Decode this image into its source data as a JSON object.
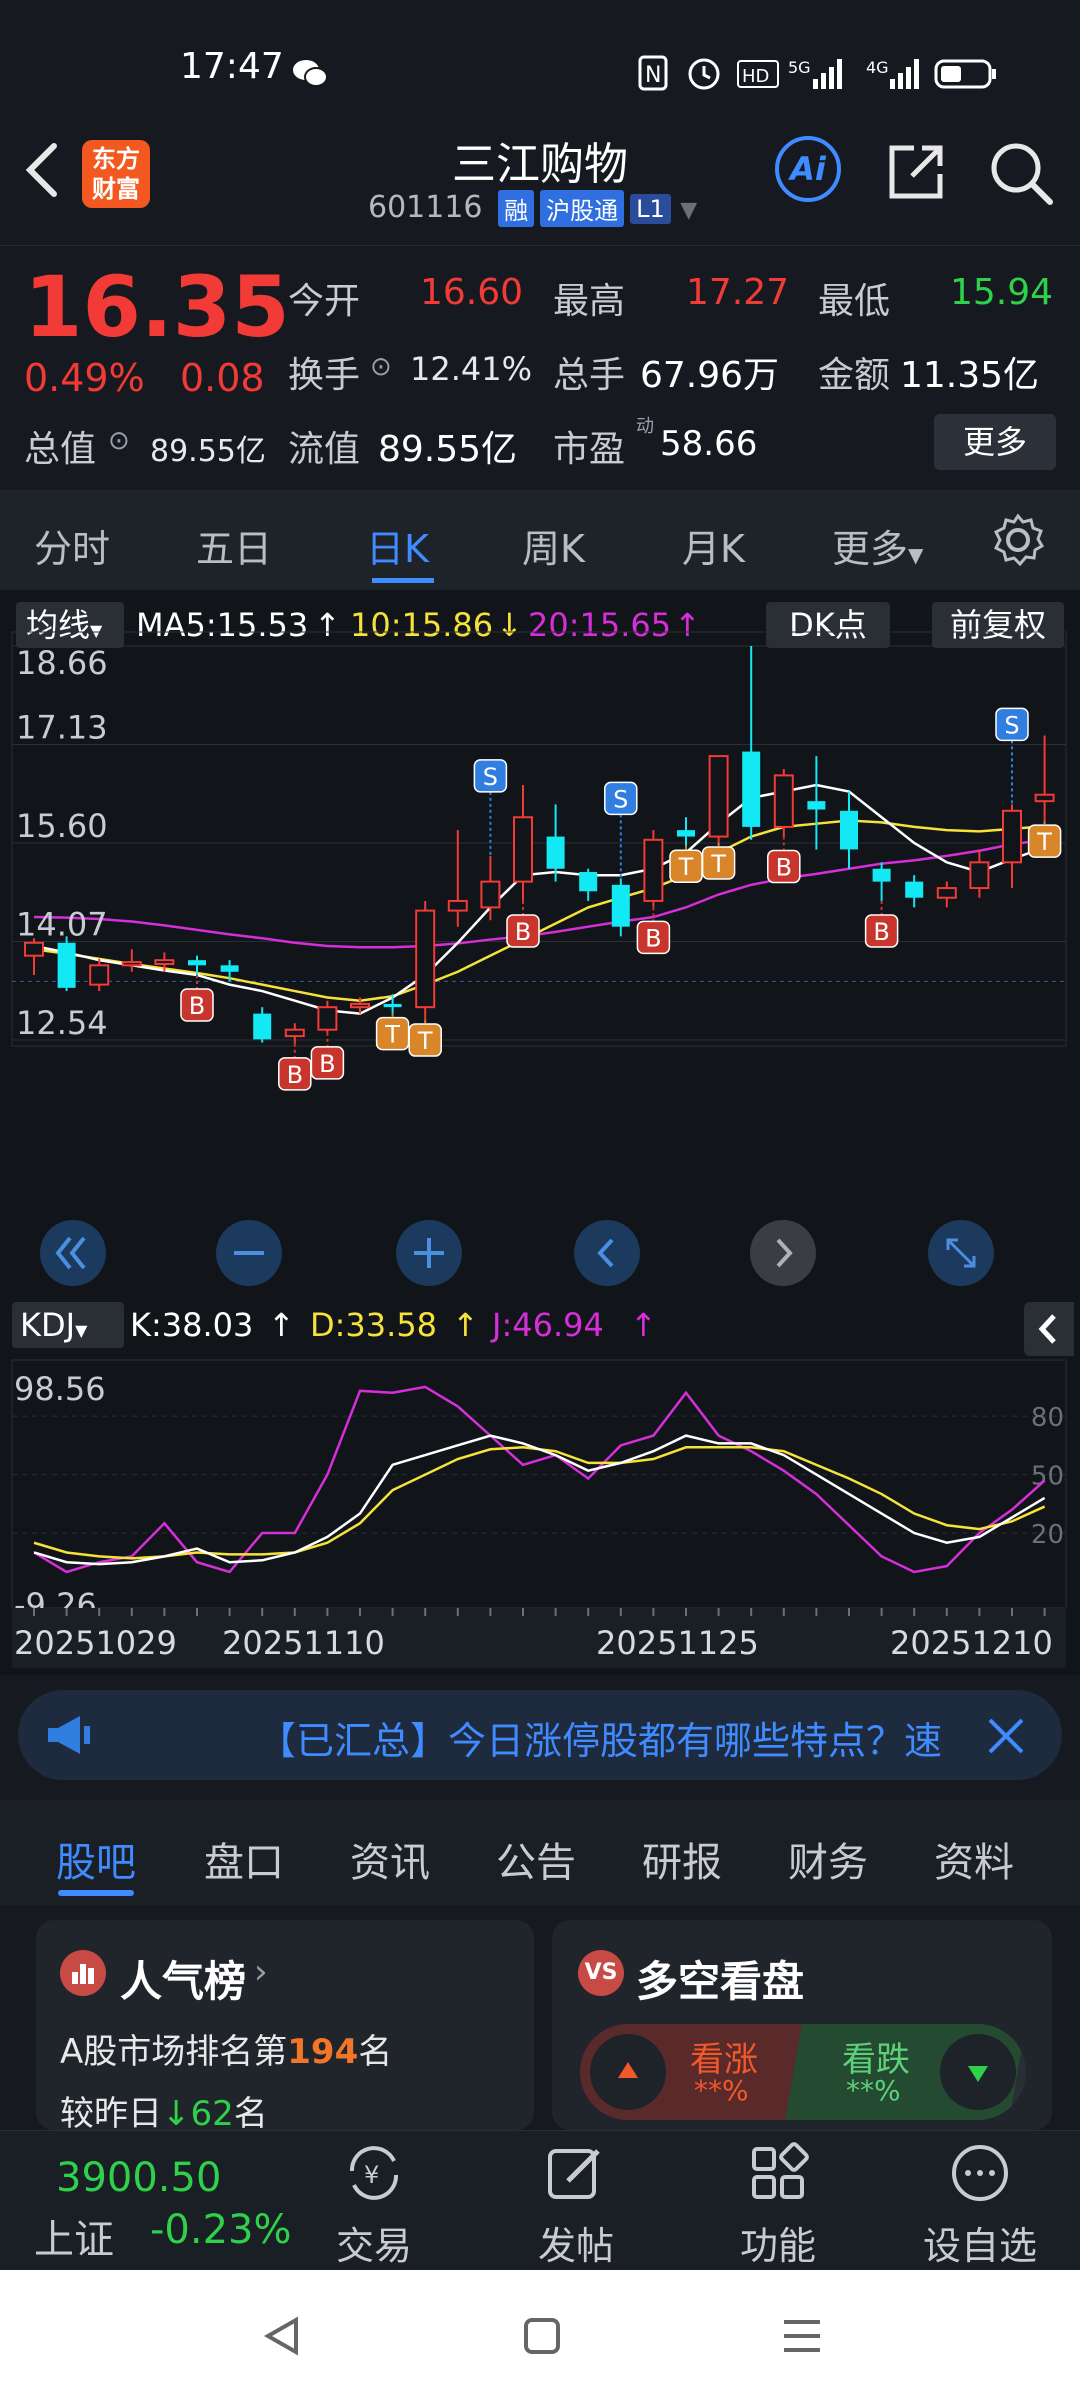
{
  "status_bar": {
    "time": "17:47",
    "icons": [
      "wechat-icon",
      "nfc-icon",
      "alarm-icon",
      "hd-icon",
      "signal-5g-icon",
      "signal-4g-icon",
      "battery-icon"
    ]
  },
  "header": {
    "stock_name": "三江购物",
    "stock_code": "601116",
    "tags": [
      "融",
      "沪股通",
      "L1"
    ],
    "logo_text": [
      "东方",
      "财富"
    ],
    "ai_label": "Ai"
  },
  "quote": {
    "price": "16.35",
    "change_pct": "0.49%",
    "change_amt": "0.08",
    "fields": {
      "open_label": "今开",
      "open": "16.60",
      "high_label": "最高",
      "high": "17.27",
      "low_label": "最低",
      "low": "15.94",
      "turnover_label": "换手",
      "turnover": "12.41%",
      "volume_label": "总手",
      "volume": "67.96万",
      "amount_label": "金额",
      "amount": "11.35亿",
      "mktcap_label": "总值",
      "mktcap": "89.55亿",
      "float_label": "流值",
      "float": "89.55亿",
      "pe_label": "市盈",
      "pe_sup": "动",
      "pe": "58.66",
      "more_label": "更多"
    }
  },
  "tabs": [
    "分时",
    "五日",
    "日K",
    "周K",
    "月K",
    "更多"
  ],
  "active_tab": 2,
  "chart": {
    "ma_legend": {
      "label": "均线",
      "ma5": "MA5:15.53",
      "ma10": "10:15.86",
      "ma20": "20:15.65"
    },
    "dk_label": "DK点",
    "adjust_label": "前复权",
    "price_axis": [
      "18.66",
      "17.13",
      "15.60",
      "14.07",
      "12.54"
    ],
    "kdj_legend": {
      "label": "KDJ",
      "k": "K:38.03",
      "d": "D:33.58",
      "j": "J:46.94"
    },
    "kdj_axis_left": [
      "98.56",
      "-9.26"
    ],
    "kdj_axis_right": [
      "80",
      "50",
      "20"
    ],
    "date_axis": [
      "20251029",
      "20251110",
      "20251125",
      "20251210"
    ],
    "colors": {
      "up": "#f23a36",
      "down": "#13e8f5",
      "ma5": "#ffffff",
      "ma10": "#f5e23a",
      "ma20": "#d62fd9",
      "buy": "#c7352d",
      "sell": "#2f7ee0",
      "t": "#d9852a"
    }
  },
  "chart_data": {
    "type": "candlestick",
    "ylim": [
      12.54,
      18.66
    ],
    "candles": [
      {
        "o": 13.85,
        "c": 14.05,
        "h": 14.12,
        "l": 13.55
      },
      {
        "o": 14.05,
        "c": 13.35,
        "h": 14.15,
        "l": 13.3
      },
      {
        "o": 13.4,
        "c": 13.7,
        "h": 13.8,
        "l": 13.3
      },
      {
        "o": 13.7,
        "c": 13.75,
        "h": 13.95,
        "l": 13.6
      },
      {
        "o": 13.72,
        "c": 13.78,
        "h": 13.9,
        "l": 13.6
      },
      {
        "o": 13.78,
        "c": 13.7,
        "h": 13.85,
        "l": 13.55
      },
      {
        "o": 13.7,
        "c": 13.6,
        "h": 13.78,
        "l": 13.45
      },
      {
        "o": 12.95,
        "c": 12.55,
        "h": 13.05,
        "l": 12.5
      },
      {
        "o": 12.6,
        "c": 12.7,
        "h": 12.8,
        "l": 12.48
      },
      {
        "o": 12.7,
        "c": 13.05,
        "h": 13.15,
        "l": 12.65
      },
      {
        "o": 13.05,
        "c": 13.1,
        "h": 13.2,
        "l": 12.95
      },
      {
        "o": 13.1,
        "c": 13.05,
        "h": 13.25,
        "l": 12.95
      },
      {
        "o": 13.05,
        "c": 14.55,
        "h": 14.7,
        "l": 12.85
      },
      {
        "o": 14.55,
        "c": 14.7,
        "h": 15.8,
        "l": 14.3
      },
      {
        "o": 14.6,
        "c": 15.0,
        "h": 15.4,
        "l": 14.4
      },
      {
        "o": 15.0,
        "c": 16.0,
        "h": 16.5,
        "l": 14.7
      },
      {
        "o": 15.7,
        "c": 15.2,
        "h": 16.2,
        "l": 15.0
      },
      {
        "o": 15.15,
        "c": 14.85,
        "h": 15.2,
        "l": 14.7
      },
      {
        "o": 14.95,
        "c": 14.3,
        "h": 15.05,
        "l": 14.15
      },
      {
        "o": 14.7,
        "c": 15.65,
        "h": 15.8,
        "l": 14.6
      },
      {
        "o": 15.8,
        "c": 15.7,
        "h": 16.0,
        "l": 15.55
      },
      {
        "o": 15.7,
        "c": 16.95,
        "h": 16.95,
        "l": 15.6
      },
      {
        "o": 17.02,
        "c": 15.85,
        "h": 18.66,
        "l": 15.65
      },
      {
        "o": 15.85,
        "c": 16.65,
        "h": 16.75,
        "l": 15.7
      },
      {
        "o": 16.25,
        "c": 16.12,
        "h": 16.95,
        "l": 15.5
      },
      {
        "o": 16.1,
        "c": 15.5,
        "h": 16.4,
        "l": 15.2
      },
      {
        "o": 15.2,
        "c": 15.0,
        "h": 15.3,
        "l": 14.7
      },
      {
        "o": 15.0,
        "c": 14.75,
        "h": 15.1,
        "l": 14.6
      },
      {
        "o": 14.75,
        "c": 14.9,
        "h": 15.0,
        "l": 14.6
      },
      {
        "o": 14.9,
        "c": 15.3,
        "h": 15.5,
        "l": 14.75
      },
      {
        "o": 15.3,
        "c": 16.1,
        "h": 16.2,
        "l": 14.9
      },
      {
        "o": 16.25,
        "c": 16.35,
        "h": 17.27,
        "l": 15.94
      }
    ],
    "ma5": [
      14.0,
      13.9,
      13.78,
      13.7,
      13.62,
      13.55,
      13.4,
      13.3,
      13.15,
      13.0,
      12.95,
      13.2,
      13.55,
      14.05,
      14.6,
      15.1,
      15.15,
      15.1,
      15.1,
      15.2,
      15.45,
      15.9,
      16.3,
      16.4,
      16.5,
      16.4,
      16.0,
      15.6,
      15.3,
      15.15,
      15.35,
      15.53
    ],
    "ma10": [
      13.95,
      13.88,
      13.8,
      13.72,
      13.65,
      13.58,
      13.5,
      13.4,
      13.3,
      13.2,
      13.15,
      13.22,
      13.4,
      13.6,
      13.85,
      14.1,
      14.35,
      14.6,
      14.75,
      14.9,
      15.1,
      15.45,
      15.7,
      15.85,
      15.9,
      15.95,
      15.92,
      15.85,
      15.8,
      15.78,
      15.82,
      15.86
    ],
    "ma20": [
      14.45,
      14.44,
      14.42,
      14.38,
      14.32,
      14.25,
      14.18,
      14.12,
      14.05,
      14.0,
      13.98,
      13.98,
      14.0,
      14.04,
      14.1,
      14.15,
      14.22,
      14.3,
      14.38,
      14.45,
      14.6,
      14.8,
      14.95,
      15.05,
      15.12,
      15.2,
      15.28,
      15.33,
      15.4,
      15.48,
      15.58,
      15.65
    ],
    "signals": [
      {
        "i": 6,
        "type": "B"
      },
      {
        "i": 9,
        "type": "B"
      },
      {
        "i": 10,
        "type": "B"
      },
      {
        "i": 12,
        "type": "T"
      },
      {
        "i": 13,
        "type": "T"
      },
      {
        "i": 15,
        "type": "S"
      },
      {
        "i": 16,
        "type": "B"
      },
      {
        "i": 19,
        "type": "S"
      },
      {
        "i": 20,
        "type": "B"
      },
      {
        "i": 21,
        "type": "T"
      },
      {
        "i": 22,
        "type": "T"
      },
      {
        "i": 24,
        "type": "B"
      },
      {
        "i": 27,
        "type": "B"
      },
      {
        "i": 31,
        "type": "S"
      },
      {
        "i": 32,
        "type": "T"
      }
    ],
    "kdj_ylim": [
      -9.26,
      98.56
    ],
    "k": [
      10,
      5,
      4,
      5,
      8,
      12,
      5,
      6,
      10,
      18,
      30,
      55,
      60,
      65,
      70,
      66,
      60,
      52,
      56,
      62,
      70,
      66,
      66,
      60,
      50,
      40,
      30,
      20,
      15,
      18,
      28,
      38.03
    ],
    "d": [
      15,
      10,
      8,
      7,
      8,
      10,
      9,
      9,
      10,
      15,
      25,
      42,
      50,
      58,
      63,
      64,
      62,
      56,
      56,
      58,
      64,
      64,
      64,
      62,
      55,
      48,
      40,
      30,
      24,
      22,
      26,
      33.58
    ],
    "j": [
      10,
      0,
      5,
      8,
      25,
      5,
      0,
      20,
      20,
      50,
      93,
      92,
      95,
      85,
      70,
      55,
      60,
      48,
      65,
      70,
      92,
      70,
      62,
      52,
      40,
      24,
      8,
      0,
      3,
      20,
      32,
      46.94
    ]
  },
  "chart_controls": [
    "double-left-icon",
    "minus-icon",
    "plus-icon",
    "prev-icon",
    "next-icon",
    "expand-icon"
  ],
  "banner": {
    "text": "【已汇总】今日涨停股都有哪些特点？速"
  },
  "subtabs": [
    "股吧",
    "盘口",
    "资讯",
    "公告",
    "研报",
    "财务",
    "资料"
  ],
  "active_subtab": 0,
  "popularity_card": {
    "title": "人气榜",
    "rank_prefix": "A股市场排名第",
    "rank": "194",
    "rank_suffix": "名",
    "change_prefix": "较昨日",
    "change": "62",
    "change_suffix": "名"
  },
  "vs_card": {
    "title": "多空看盘",
    "up_label": "看涨",
    "up_value": "**%",
    "down_label": "看跌",
    "down_value": "**%"
  },
  "bottom_nav": {
    "index_value": "3900.50",
    "index_name": "上证",
    "index_change": "-0.23%",
    "items": [
      "交易",
      "发帖",
      "功能",
      "设自选"
    ]
  }
}
